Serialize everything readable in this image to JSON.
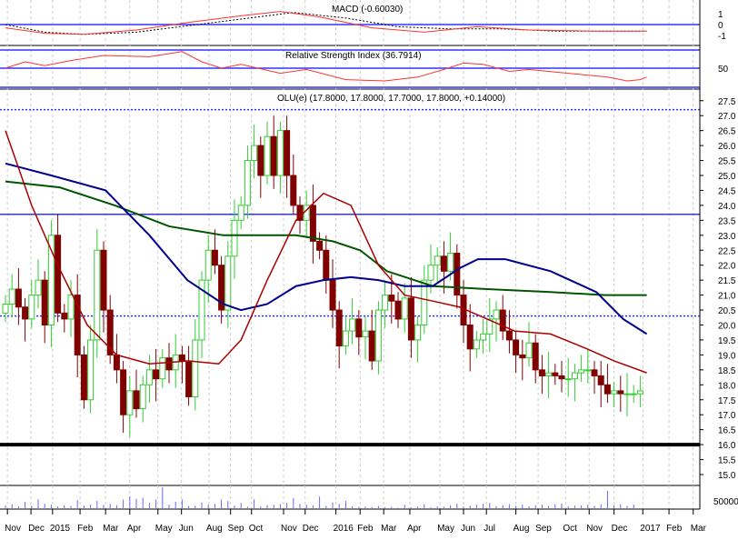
{
  "chart_data": {
    "type": "candlestick",
    "title": "OLU(e) (17.8000, 17.8000, 17.7000, 17.8000, +0.14000)",
    "macd_label": "MACD (-0.60030)",
    "rsi_label": "Relative Strength Index (36.7914)",
    "x_tick_labels": [
      "Nov",
      "Dec",
      "2015",
      "Feb",
      "Mar",
      "Apr",
      "May",
      "Jun",
      "Aug",
      "Sep",
      "Oct",
      "Nov",
      "Dec",
      "2016",
      "Feb",
      "Mar",
      "Apr",
      "May",
      "Jun",
      "Jul",
      "Aug",
      "Sep",
      "Oct",
      "Nov",
      "Dec",
      "2017",
      "Feb",
      "Mar"
    ],
    "x_tick_weeks": [
      0.3,
      3.9,
      7.2,
      11.4,
      15.3,
      19,
      23.3,
      26.9,
      31.1,
      34.4,
      37.6,
      42.5,
      45.8,
      50.5,
      54.2,
      57.8,
      61.8,
      66.4,
      70,
      73.5,
      78,
      81.4,
      85.6,
      89.2,
      93,
      97.4,
      101.4,
      105.1
    ],
    "y_ticks": [
      27.5,
      27.0,
      26.5,
      26.0,
      25.5,
      25.0,
      24.5,
      24.0,
      23.5,
      23.0,
      22.5,
      22.0,
      21.5,
      21.0,
      20.5,
      20.0,
      19.5,
      19.0,
      18.5,
      18.0,
      17.5,
      17.0,
      16.5,
      16.0,
      15.5,
      15.0
    ],
    "ylim": [
      15,
      27.5
    ],
    "macd_ticks": [
      "1",
      "0",
      "-1"
    ],
    "rsi_ticks": [
      "50"
    ],
    "volume_ticks": [
      "50000"
    ],
    "closes": [
      20.7,
      21.2,
      20.6,
      20.2,
      21.0,
      21.5,
      20.0,
      23.0,
      20.4,
      20.2,
      21.0,
      19.0,
      17.5,
      19.5,
      22.5,
      20.5,
      19.0,
      18.5,
      17.0,
      17.8,
      17.2,
      18.0,
      18.5,
      18.2,
      18.9,
      18.5,
      19.0,
      18.8,
      17.6,
      19.5,
      21.5,
      22.5,
      22.0,
      20.5,
      22.3,
      23.5,
      24.0,
      25.5,
      26.0,
      25.0,
      26.3,
      25.0,
      26.5,
      25.0,
      24.0,
      23.5,
      24.0,
      22.8,
      22.5,
      21.5,
      20.5,
      19.3,
      19.8,
      20.2,
      19.6,
      19.8,
      18.8,
      20.5,
      21.0,
      20.8,
      20.2,
      20.9,
      19.5,
      20.0,
      21.5,
      22.0,
      22.3,
      21.8,
      22.4,
      21.0,
      20.0,
      19.2,
      19.5,
      19.7,
      20.2,
      20.5,
      19.8,
      19.5,
      19.0,
      18.9,
      19.4,
      18.5,
      18.3,
      18.4,
      18.3,
      18.2,
      18.2,
      18.4,
      18.5,
      18.5,
      18.3,
      18.0,
      17.7,
      17.8,
      17.7,
      17.7,
      17.7,
      17.8
    ],
    "volumes": [
      9000,
      14000,
      6000,
      22000,
      8000,
      30000,
      15000,
      12000,
      6000,
      10000,
      8000,
      28000,
      9000,
      12000,
      25000,
      11000,
      15000,
      10000,
      30000,
      40000,
      32000,
      36000,
      18000,
      30000,
      75000,
      12000,
      22000,
      30000,
      8000,
      9000,
      20000,
      12000,
      15000,
      30000,
      25000,
      9000,
      18000,
      5000,
      30000,
      6000,
      10000,
      12000,
      14000,
      18000,
      35000,
      15000,
      12000,
      10000,
      40000,
      8000,
      20000,
      15000,
      25000,
      6000,
      4000,
      5000,
      4000,
      8000,
      3000,
      4000,
      2000,
      12000,
      3000,
      5000,
      14000,
      3000,
      6000,
      5000,
      10000,
      16000,
      6000,
      9000,
      12000,
      15000,
      18000,
      7000,
      10000,
      14000,
      8000,
      12000,
      6000,
      10000,
      12000,
      8000,
      14000,
      16000,
      6000,
      9000,
      10000,
      12000,
      8000,
      14000,
      60000,
      10000,
      14000,
      8000,
      12000
    ],
    "ma_fast": [
      [
        0,
        26.5
      ],
      [
        4,
        24
      ],
      [
        8,
        22
      ],
      [
        12.5,
        20
      ],
      [
        17,
        19
      ],
      [
        22,
        18.7
      ],
      [
        28,
        18.8
      ],
      [
        32.6,
        18.7
      ],
      [
        36,
        19.5
      ],
      [
        40,
        21.5
      ],
      [
        44.4,
        23.5
      ],
      [
        48.6,
        24.4
      ],
      [
        52.8,
        24
      ],
      [
        57,
        22
      ],
      [
        61,
        21
      ],
      [
        65.3,
        20.8
      ],
      [
        69.4,
        20.6
      ],
      [
        73.6,
        20.2
      ],
      [
        77.8,
        19.8
      ],
      [
        83.3,
        19.7
      ],
      [
        88.9,
        19.2
      ],
      [
        93,
        18.8
      ],
      [
        98,
        18.4
      ]
    ],
    "ma_mid": [
      [
        0,
        25.4
      ],
      [
        7,
        25
      ],
      [
        15.3,
        24.5
      ],
      [
        22,
        23
      ],
      [
        27.8,
        21.5
      ],
      [
        33.3,
        20.7
      ],
      [
        36,
        20.5
      ],
      [
        40,
        20.7
      ],
      [
        44.4,
        21.3
      ],
      [
        48.6,
        21.5
      ],
      [
        52.8,
        21.6
      ],
      [
        57,
        21.5
      ],
      [
        61,
        21.3
      ],
      [
        65.3,
        21.3
      ],
      [
        69.4,
        21.9
      ],
      [
        72.2,
        22.2
      ],
      [
        76.4,
        22.2
      ],
      [
        83.3,
        21.8
      ],
      [
        90.3,
        21.1
      ],
      [
        94.4,
        20.2
      ],
      [
        98,
        19.7
      ]
    ],
    "ma_slow": [
      [
        0,
        24.8
      ],
      [
        8.3,
        24.6
      ],
      [
        16.7,
        24
      ],
      [
        25,
        23.3
      ],
      [
        33.3,
        23
      ],
      [
        44.4,
        23
      ],
      [
        50,
        22.8
      ],
      [
        54.2,
        22.5
      ],
      [
        58.3,
        21.8
      ],
      [
        65.3,
        21.3
      ],
      [
        73.6,
        21.2
      ],
      [
        83.3,
        21.1
      ],
      [
        91.7,
        21
      ],
      [
        98,
        21
      ]
    ],
    "hlines": [
      {
        "value": 27.2,
        "style": "dotted"
      },
      {
        "value": 23.7,
        "style": "solid"
      },
      {
        "value": 20.3,
        "style": "dotted"
      },
      {
        "value": 16.0,
        "style": "thick-black"
      }
    ],
    "macd": [
      [
        0,
        -0.3
      ],
      [
        6,
        -0.8
      ],
      [
        12,
        -0.9
      ],
      [
        20,
        -0.5
      ],
      [
        28,
        0.2
      ],
      [
        36,
        0.8
      ],
      [
        42,
        1.2
      ],
      [
        48,
        0.7
      ],
      [
        56,
        -0.3
      ],
      [
        64,
        -0.7
      ],
      [
        72,
        -0.2
      ],
      [
        80,
        -0.5
      ],
      [
        90,
        -0.6
      ],
      [
        98,
        -0.6
      ]
    ],
    "macd_signal": [
      [
        0,
        0
      ],
      [
        6,
        -0.7
      ],
      [
        12,
        -0.9
      ],
      [
        20,
        -0.7
      ],
      [
        28,
        -0.1
      ],
      [
        36,
        0.5
      ],
      [
        44,
        1.1
      ],
      [
        52,
        0.6
      ],
      [
        60,
        -0.2
      ],
      [
        68,
        -0.4
      ],
      [
        76,
        -0.4
      ],
      [
        84,
        -0.6
      ],
      [
        98,
        -0.6
      ]
    ],
    "rsi": [
      [
        0,
        60
      ],
      [
        3,
        70
      ],
      [
        6,
        64
      ],
      [
        10,
        72
      ],
      [
        15,
        80
      ],
      [
        22,
        78
      ],
      [
        27,
        86
      ],
      [
        30,
        70
      ],
      [
        33,
        60
      ],
      [
        36,
        66
      ],
      [
        42,
        52
      ],
      [
        46,
        58
      ],
      [
        52,
        42
      ],
      [
        58,
        40
      ],
      [
        63,
        46
      ],
      [
        67,
        58
      ],
      [
        70,
        68
      ],
      [
        73,
        66
      ],
      [
        77,
        55
      ],
      [
        80,
        58
      ],
      [
        84,
        54
      ],
      [
        88,
        50
      ],
      [
        92,
        46
      ],
      [
        95,
        40
      ],
      [
        97,
        42
      ],
      [
        98,
        46
      ]
    ],
    "colors": {
      "up": "#33cc33",
      "down": "#800000",
      "ma_fast": "#aa0000",
      "ma_mid": "#00008b",
      "ma_slow": "#005500",
      "guide": "#3333ff",
      "osc": "#ff3333"
    }
  }
}
